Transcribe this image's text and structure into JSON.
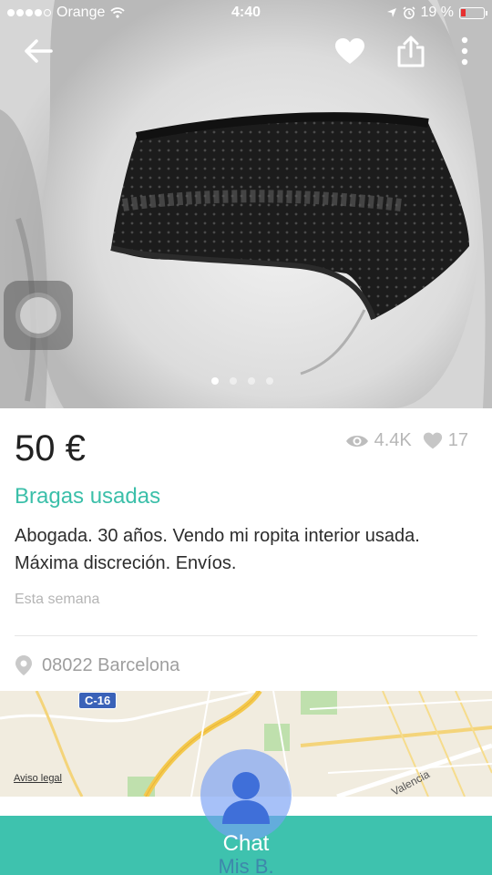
{
  "status_bar": {
    "carrier": "Orange",
    "time": "4:40",
    "battery": "19 %",
    "signal_dots": [
      true,
      true,
      true,
      true,
      false
    ]
  },
  "toolbar": {
    "back_icon": "back-arrow-icon",
    "favorite_icon": "heart-icon",
    "share_icon": "share-icon",
    "more_icon": "more-vertical-icon"
  },
  "gallery": {
    "pages": 4,
    "active_page": 1
  },
  "product": {
    "price": "50 €",
    "views": "4.4K",
    "likes": "17",
    "title": "Bragas usadas",
    "description": "Abogada. 30 años. Vendo mi ropita interior usada. Máxima discreción. Envíos.",
    "date": "Esta semana",
    "location": "08022 Barcelona"
  },
  "map": {
    "road_badge": "C-16",
    "legal_link": "Aviso legal",
    "street_label": "Valencia"
  },
  "bottom_bar": {
    "chat_label": "Chat",
    "secondary_label": "Mis B."
  },
  "colors": {
    "accent": "#3ec2ae",
    "title": "#3bbfa9",
    "battery_low": "#e63030"
  }
}
